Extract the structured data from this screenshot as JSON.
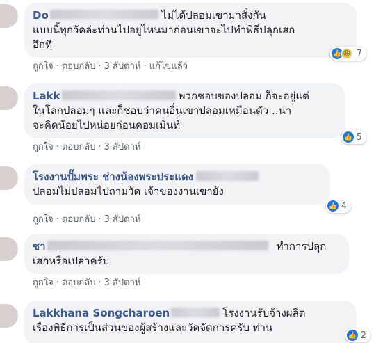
{
  "comments": [
    {
      "author": "Do",
      "text": "ไม่ได้ปลอมเขามาสั่งกันแบบนี้ทุกวัดล่ะท่านไปอยู่ไหนมาก่อนเขาจะไปทำพิธีปลุกเสกอีกที",
      "line1": "ไม่ได้ปลอมเขามาสั่งกัน",
      "line2": "แบบนี้ทุกวัดล่ะท่านไปอยู่ไหนมาก่อนเขาจะไปทำพิธีปลุกเสก",
      "line3": "อีกที",
      "like": "ถูกใจ",
      "reply": "ตอบกลับ",
      "time": "3 สัปดาห์",
      "edited": "แก้ไขแล้ว",
      "reaction_count": "7",
      "reaction_icons": [
        "like-icon",
        "haha-icon"
      ]
    },
    {
      "author": "Lakk",
      "line1": "พวกชอบของปลอม ก็จะอยู่แต่",
      "line2": "ในโลกปลอมๆ และก็ชอบว่าคนอื่นเขาปลอมเหมือนตัว ..น่า",
      "line3": "จะคิดน้อยไปหน่อยก่อนคอมเม้นท์",
      "like": "ถูกใจ",
      "reply": "ตอบกลับ",
      "time": "3 สัปดาห์",
      "reaction_count": "5",
      "reaction_icons": [
        "like-icon"
      ]
    },
    {
      "author": "โรงงานปั๊มพระ ช่างน้องพระประแดง",
      "line1": "ปลอมไม่ปลอมไปถามวัด เจ้าของงานเขายัง",
      "like": "ถูกใจ",
      "reply": "ตอบกลับ",
      "time": "3 สัปดาห์",
      "reaction_count": "4",
      "reaction_icons": [
        "like-icon"
      ]
    },
    {
      "author": "ชา",
      "line1": "ทำการปลุก",
      "line2": "เสกหรือเปล่าครับ",
      "like": "ถูกใจ",
      "reply": "ตอบกลับ",
      "time": "3 สัปดาห์"
    },
    {
      "author": "Lakkhana Songcharoen",
      "line1": "โรงงานรับจ้างผลิต",
      "line2": "เรื่องพิธีการเป็นส่วนของผู้สร้างและวัดจัดการครับ ท่าน",
      "reaction_count": "2",
      "reaction_icons": [
        "like-icon"
      ]
    }
  ]
}
